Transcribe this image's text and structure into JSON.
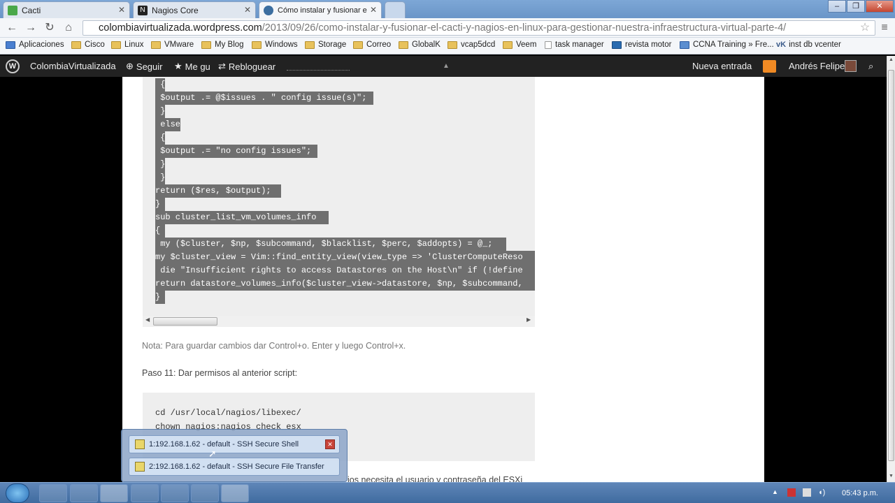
{
  "tabs": [
    {
      "title": "Cacti",
      "icon": "cacti-icon",
      "color": "#4aa84a"
    },
    {
      "title": "Nagios Core",
      "icon": "nagios-icon",
      "color": "#222222"
    },
    {
      "title": "Cómo instalar y fusionar e",
      "icon": "wordpress-icon",
      "color": "#3c6ea0"
    }
  ],
  "address": {
    "domain": "colombiavirtualizada.wordpress.com",
    "path": "/2013/09/26/como-instalar-y-fusionar-el-cacti-y-nagios-en-linux-para-gestionar-nuestra-infraestructura-virtual-parte-4/"
  },
  "bookmarks": [
    "Aplicaciones",
    "Cisco",
    "Linux",
    "VMware",
    "My Blog",
    "Windows",
    "Storage",
    "Correo",
    "GlobalK",
    "vcap5dcd",
    "Veem",
    "task manager",
    "revista motor",
    "CCNA Training » Fre...",
    "inst db vcenter"
  ],
  "wpbar": {
    "site": "ColombiaVirtualizada",
    "follow": "Seguir",
    "like": "Me gu",
    "reblog": "Rebloguear",
    "new_post": "Nueva entrada",
    "user": "Andrés Felipe"
  },
  "code_lines": [
    " {",
    " $output .= @$issues . \" config issue(s)\";",
    " }",
    " else",
    " {",
    " $output .= \"no config issues\";",
    " }",
    " }",
    "return ($res, $output);",
    "}",
    "sub cluster_list_vm_volumes_info",
    "{",
    " my ($cluster, $np, $subcommand, $blacklist, $perc, $addopts) = @_;",
    "my $cluster_view = Vim::find_entity_view(view_type => 'ClusterComputeReso",
    " die \"Insufficient rights to access Datastores on the Host\\n\" if (!define",
    "return datastore_volumes_info($cluster_view->datastore, $np, $subcommand,",
    "}"
  ],
  "note": "Nota: Para guardar cambios dar Control+o. Enter y luego Control+x.",
  "step11": "Paso 11: Dar permisos al anterior script:",
  "code2_lines": [
    "cd /usr/local/nagios/libexec/",
    "chown nagios:nagios check_esx"
  ],
  "bottom_text": "ios necesita el usuario y contraseña del ESXi",
  "popup_items": [
    "1:192.168.1.62 - default - SSH Secure Shell",
    "2:192.168.1.62 - default - SSH Secure File Transfer"
  ],
  "clock": "05:43 p.m."
}
